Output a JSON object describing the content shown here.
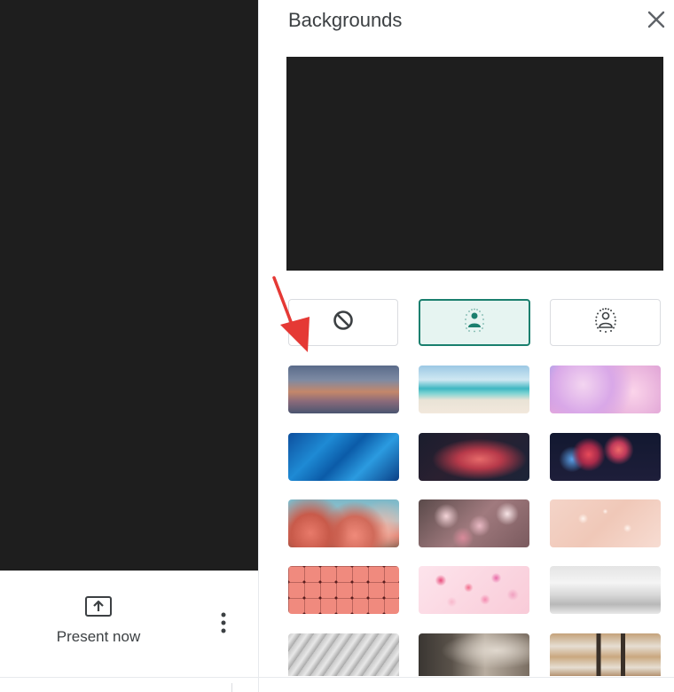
{
  "panel": {
    "title": "Backgrounds",
    "close_icon": "close-icon"
  },
  "effects": [
    {
      "name": "no-effect",
      "icon": "block-icon",
      "selected": false
    },
    {
      "name": "slightly-blur",
      "icon": "person-blur-light-icon",
      "selected": true
    },
    {
      "name": "blur",
      "icon": "person-blur-strong-icon",
      "selected": false
    }
  ],
  "backgrounds": [
    {
      "name": "sunset-gradient"
    },
    {
      "name": "beach"
    },
    {
      "name": "pink-clouds"
    },
    {
      "name": "blue-glass"
    },
    {
      "name": "red-nebula"
    },
    {
      "name": "fireworks"
    },
    {
      "name": "pink-blossom-sky"
    },
    {
      "name": "flower-field"
    },
    {
      "name": "peach-sparkle"
    },
    {
      "name": "pink-pattern"
    },
    {
      "name": "confetti"
    },
    {
      "name": "white-office"
    },
    {
      "name": "greyscale-room"
    },
    {
      "name": "loft-room"
    },
    {
      "name": "bookshelf"
    }
  ],
  "toolbar": {
    "present_label": "Present now",
    "present_icon": "present-screen-icon",
    "more_icon": "more-vert-icon"
  },
  "colors": {
    "accent": "#1a7f6e",
    "selected_bg": "#e6f4f1",
    "arrow": "#e53935",
    "video_bg": "#1e1e1e"
  }
}
